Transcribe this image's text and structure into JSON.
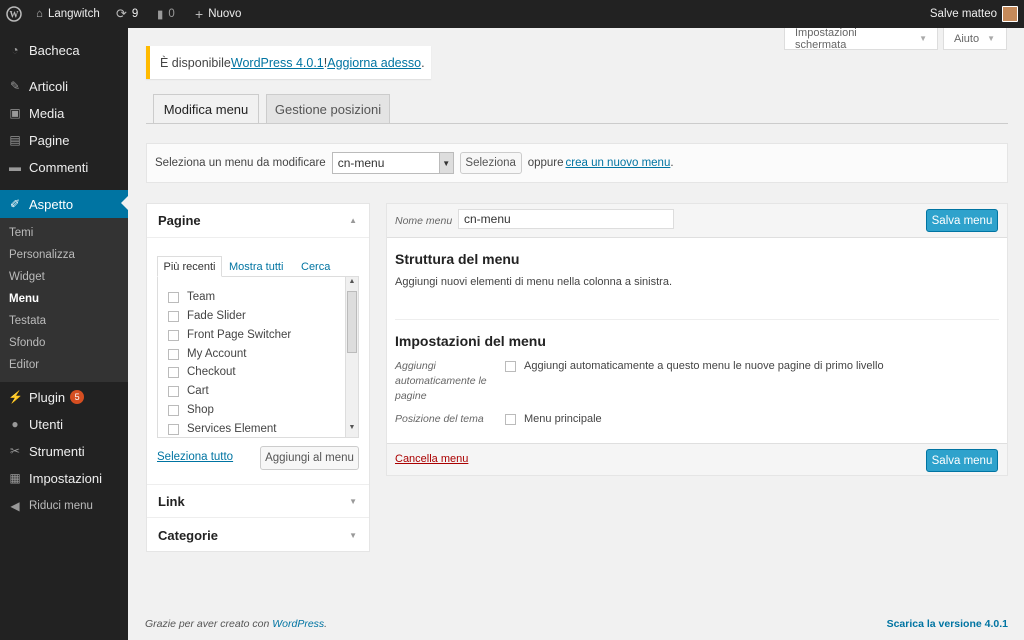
{
  "adminbar": {
    "site_name": "Langwitch",
    "updates_count": "9",
    "comments_count": "0",
    "new_label": "Nuovo",
    "greeting": "Salve matteo"
  },
  "sidebar": {
    "items": [
      {
        "label": "Bacheca",
        "icon": "dashboard-icon"
      },
      {
        "label": "Articoli",
        "icon": "pin-icon"
      },
      {
        "label": "Media",
        "icon": "media-icon"
      },
      {
        "label": "Pagine",
        "icon": "pages-icon"
      },
      {
        "label": "Commenti",
        "icon": "comment-icon"
      },
      {
        "label": "Aspetto",
        "icon": "brush-icon"
      },
      {
        "label": "Plugin",
        "icon": "plugin-icon",
        "badge": "5"
      },
      {
        "label": "Utenti",
        "icon": "user-icon"
      },
      {
        "label": "Strumenti",
        "icon": "wrench-icon"
      },
      {
        "label": "Impostazioni",
        "icon": "settings-icon"
      },
      {
        "label": "Riduci menu",
        "icon": "collapse-icon"
      }
    ],
    "submenu": [
      "Temi",
      "Personalizza",
      "Widget",
      "Menu",
      "Testata",
      "Sfondo",
      "Editor"
    ]
  },
  "screen_options": "Impostazioni schermata",
  "help": "Aiuto",
  "notice": {
    "prefix": "È disponibile ",
    "version_link": "WordPress 4.0.1",
    "middle": "! ",
    "update_link": "Aggiorna adesso",
    "suffix": "."
  },
  "tabs": [
    "Modifica menu",
    "Gestione posizioni"
  ],
  "select_bar": {
    "label": "Seleziona un menu da modificare",
    "selected": "cn-menu",
    "select_button": "Seleziona",
    "or_text": "oppure",
    "create_link": "crea un nuovo menu",
    "period": "."
  },
  "left_panel": {
    "pages_title": "Pagine",
    "tabs": [
      "Più recenti",
      "Mostra tutti",
      "Cerca"
    ],
    "items": [
      "Team",
      "Fade Slider",
      "Front Page Switcher",
      "My Account",
      "Checkout",
      "Cart",
      "Shop",
      "Services Element"
    ],
    "select_all": "Seleziona tutto",
    "add_button": "Aggiungi al menu",
    "link_title": "Link",
    "categories_title": "Categorie"
  },
  "right_panel": {
    "menu_name_label": "Nome menu",
    "menu_name_value": "cn-menu",
    "save_button": "Salva menu",
    "structure_title": "Struttura del menu",
    "structure_help": "Aggiungi nuovi elementi di menu nella colonna a sinistra.",
    "settings_title": "Impostazioni del menu",
    "auto_add_label": "Aggiungi automaticamente le pagine",
    "auto_add_option": "Aggiungi automaticamente a questo menu le nuove pagine di primo livello",
    "theme_location_label": "Posizione del tema",
    "theme_location_option": "Menu principale",
    "delete_link": "Cancella menu"
  },
  "footer": {
    "thanks": "Grazie per aver creato con ",
    "wp_link": "WordPress",
    "thanks_end": ".",
    "version": "Scarica la versione 4.0.1"
  },
  "colors": {
    "accent": "#0074a2",
    "primary_button": "#2ea2cc",
    "notice_border": "#ffba00",
    "badge": "#d54e21"
  }
}
